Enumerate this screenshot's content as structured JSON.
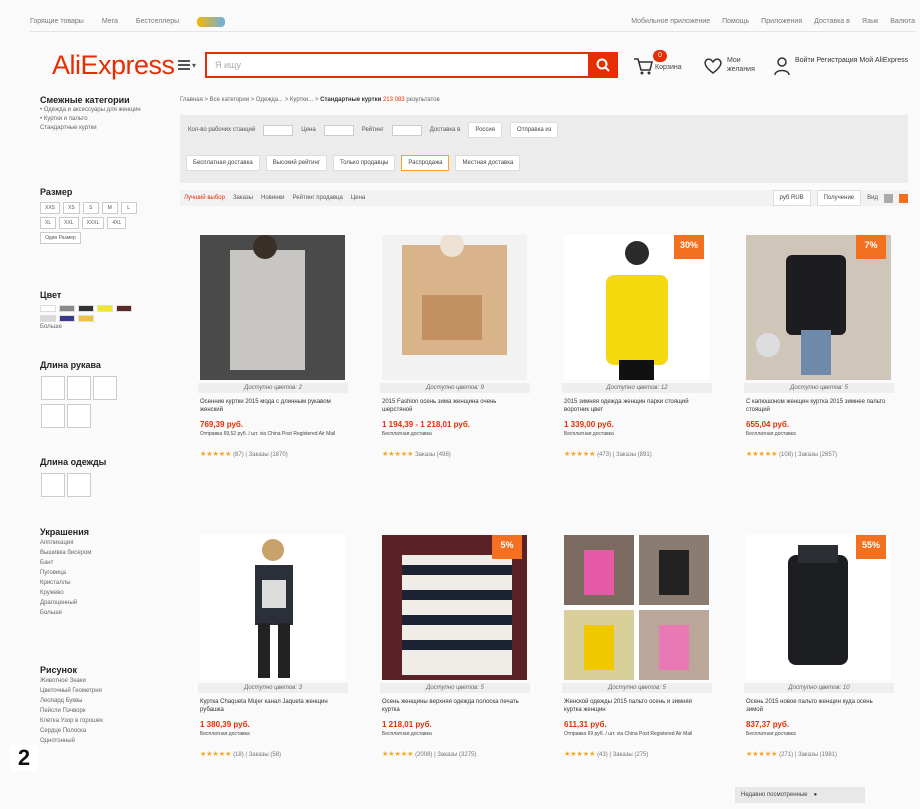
{
  "page_number": "2",
  "topnav": {
    "left": [
      "Горящие товары",
      "Мега",
      "Бестселлеры"
    ],
    "right": [
      "Мобильное приложение",
      "Помощь",
      "Приложения",
      "Доставка в",
      "Язык",
      "Валюта"
    ]
  },
  "header": {
    "logo": "AliExpress",
    "search_placeholder": "Я ищу",
    "cart_count": "0",
    "cart_label": "Корзина",
    "wish_label": "Мои желания",
    "account_label": "Войти  Регистрация  Мой AliExpress"
  },
  "sidebar": {
    "categories_title": "Смежные категории",
    "categories_lines": [
      "• Одежда и аксессуары для женщин",
      "• Куртки и пальто",
      "Стандартные куртки"
    ],
    "size_title": "Размер",
    "sizes": [
      "XXS",
      "XS",
      "S",
      "M",
      "L",
      "XL",
      "XXL",
      "XXXL",
      "4XL",
      "Один Размер"
    ],
    "color_title": "Цвет",
    "colors": [
      "#ffffff",
      "#888888",
      "#333333",
      "#f2e23a",
      "#5a2a2a",
      "#d8d8d8",
      "#3a3a8a",
      "#f0c040"
    ],
    "color_more": "Больше",
    "sleeve_title": "Длина рукава",
    "length_title": "Длина одежды",
    "decor_title": "Украшения",
    "decor_items": [
      "Аппликация",
      "Вышивка бисером",
      "Бант",
      "Пуговица",
      "Кристаллы",
      "Кружево",
      "Драгоценный"
    ],
    "decor_more": "Больше",
    "pattern_title": "Рисунок",
    "pattern_items": [
      "Животное  Знаки",
      "Цветочный  Геометрия",
      "Леопард  Буквы",
      "Пейсли  Пэчворк",
      "Клетка  Узор в горошек",
      "Сердце  Полоска",
      "Однотонный"
    ]
  },
  "main": {
    "breadcrumb_prefix": "Главная > Все категории > Одежда... > Куртки... > ",
    "breadcrumb_current": "Стандартные куртки",
    "breadcrumb_count": "213 083",
    "breadcrumb_suffix": "результатов",
    "filter_line1": [
      "Кол-во рабочих станций",
      "Цена",
      "Рейтинг",
      "Доставка в",
      "Россия",
      "Отправка из"
    ],
    "chips": [
      "Бесплатная доставка",
      "Высокий рейтинг",
      "Только продавцы",
      "Распродажа",
      "Местная доставка"
    ],
    "sort_items": [
      "Лучший выбор",
      "Заказы",
      "Новинки",
      "Рейтинг продавца",
      "Цена"
    ],
    "sort_right": [
      "руб RUB",
      "Получение",
      "Вид"
    ]
  },
  "products": [
    {
      "colors": "Доступно цветов: 2",
      "title": "Осенние куртки 2015 мода с длинным рукавом женский",
      "price": "769,39 руб.",
      "ship": "Отправка 69,52 руб. / шт. via China Post Registered Air Mail",
      "rating": "(87)  |  Заказы (1870)",
      "discount": ""
    },
    {
      "colors": "Доступно цветов: 9",
      "title": "2015 Fashion осень зима женщина очень шерстяной",
      "price": "1 194,39 - 1 218,01 руб.",
      "ship": "Бесплатная доставка",
      "rating": "Заказы (498)",
      "discount": ""
    },
    {
      "colors": "Доступно цветов: 12",
      "title": "2015 зимняя одежда женщин парки стоящий воротник цвет",
      "price": "1 339,00 руб.",
      "ship": "Бесплатная доставка",
      "rating": "(473)  |  Заказы (891)",
      "discount": "30%"
    },
    {
      "colors": "Доступно цветов: 5",
      "title": "С капюшоном женщин куртка 2015 зимнее пальто стоящий",
      "price": "655,04 руб.",
      "ship": "Бесплатная доставка",
      "rating": "(108)  |  Заказы (2657)",
      "discount": "7%"
    },
    {
      "colors": "Доступно цветов: 3",
      "title": "Куртка Chaqueta Mujer канал Jaqueta женщин рубашка",
      "price": "1 380,39 руб.",
      "ship": "Бесплатная доставка",
      "rating": "(18)  |  Заказы (58)",
      "discount": ""
    },
    {
      "colors": "Доступно цветов: 5",
      "title": "Осень женщины верхняя одежда полоска печать куртка",
      "price": "1 218,01 руб.",
      "ship": "Бесплатная доставка",
      "rating": "(2008)  |  Заказы (3275)",
      "discount": "5%"
    },
    {
      "colors": "Доступно цветов: 5",
      "title": "Женской одежды 2015 пальто осень и зимняя куртка женщин",
      "price": "611,31 руб.",
      "ship": "Отправка 69 руб. / шт. via China Post Registered Air Mail",
      "rating": "(43)  |  Заказы (275)",
      "discount": ""
    },
    {
      "colors": "Доступно цветов: 10",
      "title": "Осень 2015 новое пальто женщин куда осень зимой",
      "price": "837,37 руб.",
      "ship": "Бесплатная доставка",
      "rating": "(271)  |  Заказы (1981)",
      "discount": "55%"
    }
  ],
  "recent": "Недавно посмотренные",
  "palette": {
    "accent": "#e62e04",
    "orange": "#f37021",
    "star": "#f5a623"
  }
}
